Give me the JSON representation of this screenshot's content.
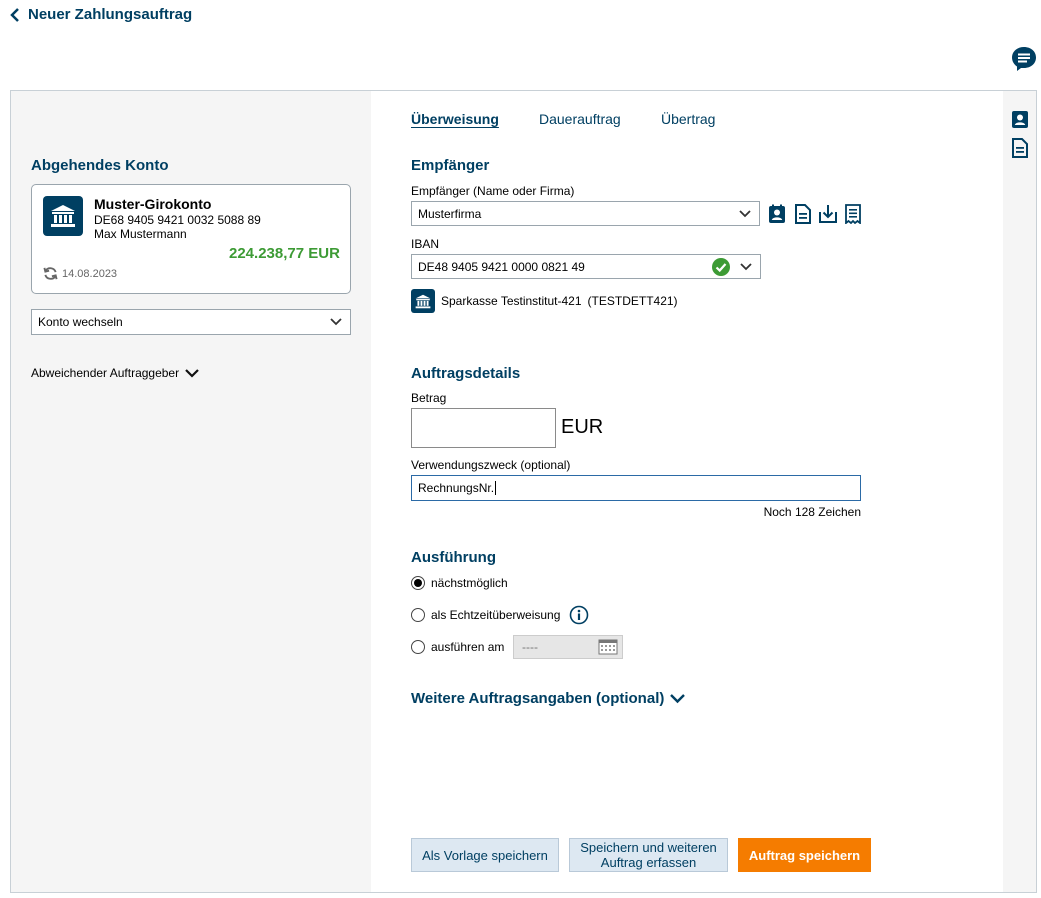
{
  "header": {
    "back_label": "Neuer Zahlungsauftrag"
  },
  "left": {
    "section_title": "Abgehendes Konto",
    "account": {
      "name": "Muster-Girokonto",
      "iban": "DE68 9405 9421 0032 5088 89",
      "holder": "Max Mustermann",
      "balance": "224.238,77 EUR",
      "updated": "14.08.2023"
    },
    "switch_account_label": "Konto wechseln",
    "different_orderer_label": "Abweichender Auftraggeber"
  },
  "tabs": [
    {
      "label": "Überweisung",
      "active": true
    },
    {
      "label": "Dauerauftrag",
      "active": false
    },
    {
      "label": "Übertrag",
      "active": false
    }
  ],
  "recipient": {
    "section_title": "Empfänger",
    "name_label": "Empfänger (Name oder Firma)",
    "name_value": "Musterfirma",
    "iban_label": "IBAN",
    "iban_value": "DE48 9405 9421 0000 0821 49",
    "bank_name": "Sparkasse Testinstitut-421",
    "bic": "(TESTDETT421)"
  },
  "order": {
    "section_title": "Auftragsdetails",
    "amount_label": "Betrag",
    "amount_value": "",
    "currency": "EUR",
    "purpose_label": "Verwendungszweck (optional)",
    "purpose_value": "RechnungsNr.",
    "remaining_chars": "Noch 128 Zeichen"
  },
  "execution": {
    "section_title": "Ausführung",
    "options": [
      {
        "label": "nächstmöglich",
        "checked": true
      },
      {
        "label": "als Echtzeitüberweisung",
        "checked": false
      },
      {
        "label": "ausführen am",
        "checked": false
      }
    ],
    "date_placeholder": "----"
  },
  "more_info_label": "Weitere Auftragsangaben (optional)",
  "buttons": {
    "template": "Als Vorlage speichern",
    "save_more": "Speichern und weiteren Auftrag erfassen",
    "save": "Auftrag speichern"
  },
  "colors": {
    "brand": "#003f62",
    "positive": "#3d9b35",
    "accent": "#f57c00"
  },
  "icons": [
    "chevron-left-icon",
    "chat-icon",
    "bank-icon",
    "refresh-icon",
    "chevron-down-icon",
    "contact-card-icon",
    "document-icon",
    "download-icon",
    "receipt-icon",
    "check-circle-icon",
    "info-icon",
    "calendar-icon"
  ]
}
